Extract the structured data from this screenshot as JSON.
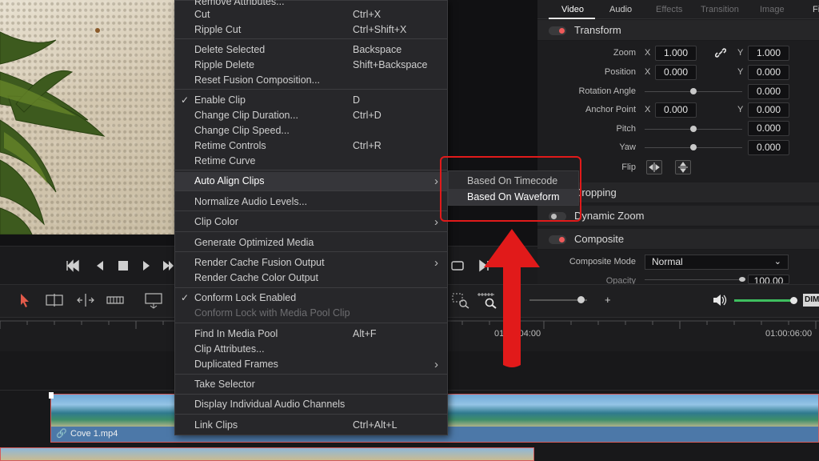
{
  "menu": {
    "items": [
      {
        "label": "Remove Attributes...",
        "shortcut": ""
      },
      {
        "label": "Cut",
        "shortcut": "Ctrl+X"
      },
      {
        "label": "Ripple Cut",
        "shortcut": "Ctrl+Shift+X"
      },
      {
        "label": "Delete Selected",
        "shortcut": "Backspace"
      },
      {
        "label": "Ripple Delete",
        "shortcut": "Shift+Backspace"
      },
      {
        "label": "Reset Fusion Composition...",
        "shortcut": ""
      },
      {
        "label": "Enable Clip",
        "shortcut": "D",
        "checked": true
      },
      {
        "label": "Change Clip Duration...",
        "shortcut": "Ctrl+D"
      },
      {
        "label": "Change Clip Speed...",
        "shortcut": ""
      },
      {
        "label": "Retime Controls",
        "shortcut": "Ctrl+R"
      },
      {
        "label": "Retime Curve",
        "shortcut": ""
      },
      {
        "label": "Auto Align Clips",
        "shortcut": "",
        "submenu": true,
        "highlighted": true
      },
      {
        "label": "Normalize Audio Levels...",
        "shortcut": ""
      },
      {
        "label": "Clip Color",
        "shortcut": "",
        "submenu": true
      },
      {
        "label": "Generate Optimized Media",
        "shortcut": ""
      },
      {
        "label": "Render Cache Fusion Output",
        "shortcut": "",
        "submenu": true
      },
      {
        "label": "Render Cache Color Output",
        "shortcut": ""
      },
      {
        "label": "Conform Lock Enabled",
        "shortcut": "",
        "checked": true
      },
      {
        "label": "Conform Lock with Media Pool Clip",
        "shortcut": "",
        "disabled": true
      },
      {
        "label": "Find In Media Pool",
        "shortcut": "Alt+F"
      },
      {
        "label": "Clip Attributes...",
        "shortcut": ""
      },
      {
        "label": "Duplicated Frames",
        "shortcut": "",
        "submenu": true
      },
      {
        "label": "Take Selector",
        "shortcut": ""
      },
      {
        "label": "Display Individual Audio Channels",
        "shortcut": ""
      },
      {
        "label": "Link Clips",
        "shortcut": "Ctrl+Alt+L"
      }
    ],
    "check_glyph": "✓",
    "arrow_glyph": "›"
  },
  "submenu": {
    "items": [
      "Based On Timecode",
      "Based On Waveform"
    ]
  },
  "inspector": {
    "tabs": [
      "Video",
      "Audio",
      "Effects",
      "Transition",
      "Image",
      "Fi"
    ],
    "sections": {
      "transform": "Transform",
      "cropping": "Cropping",
      "dynamic_zoom": "Dynamic Zoom",
      "composite": "Composite"
    },
    "props": {
      "zoom": {
        "label": "Zoom",
        "x": "1.000",
        "y": "1.000"
      },
      "position": {
        "label": "Position",
        "x": "0.000",
        "y": "0.000"
      },
      "rotation": {
        "label": "Rotation Angle",
        "value": "0.000"
      },
      "anchor": {
        "label": "Anchor Point",
        "x": "0.000",
        "y": "0.000"
      },
      "pitch": {
        "label": "Pitch",
        "value": "0.000"
      },
      "yaw": {
        "label": "Yaw",
        "value": "0.000"
      },
      "flip": {
        "label": "Flip"
      },
      "composite_mode": {
        "label": "Composite Mode",
        "value": "Normal"
      },
      "opacity": {
        "label": "Opacity",
        "value": "100.00"
      }
    },
    "axis_x": "X",
    "axis_y": "Y"
  },
  "timeline": {
    "timecodes": [
      "01:00:04:00",
      "01:00:06:00"
    ],
    "clip_name": "Cove 1.mp4",
    "dim_label": "DIM"
  },
  "colors": {
    "accent_red": "#e11a1a",
    "toggle_on": "#ee5a5a",
    "audio_green": "#3fbf5f",
    "clip_blue": "#4c78a8"
  }
}
